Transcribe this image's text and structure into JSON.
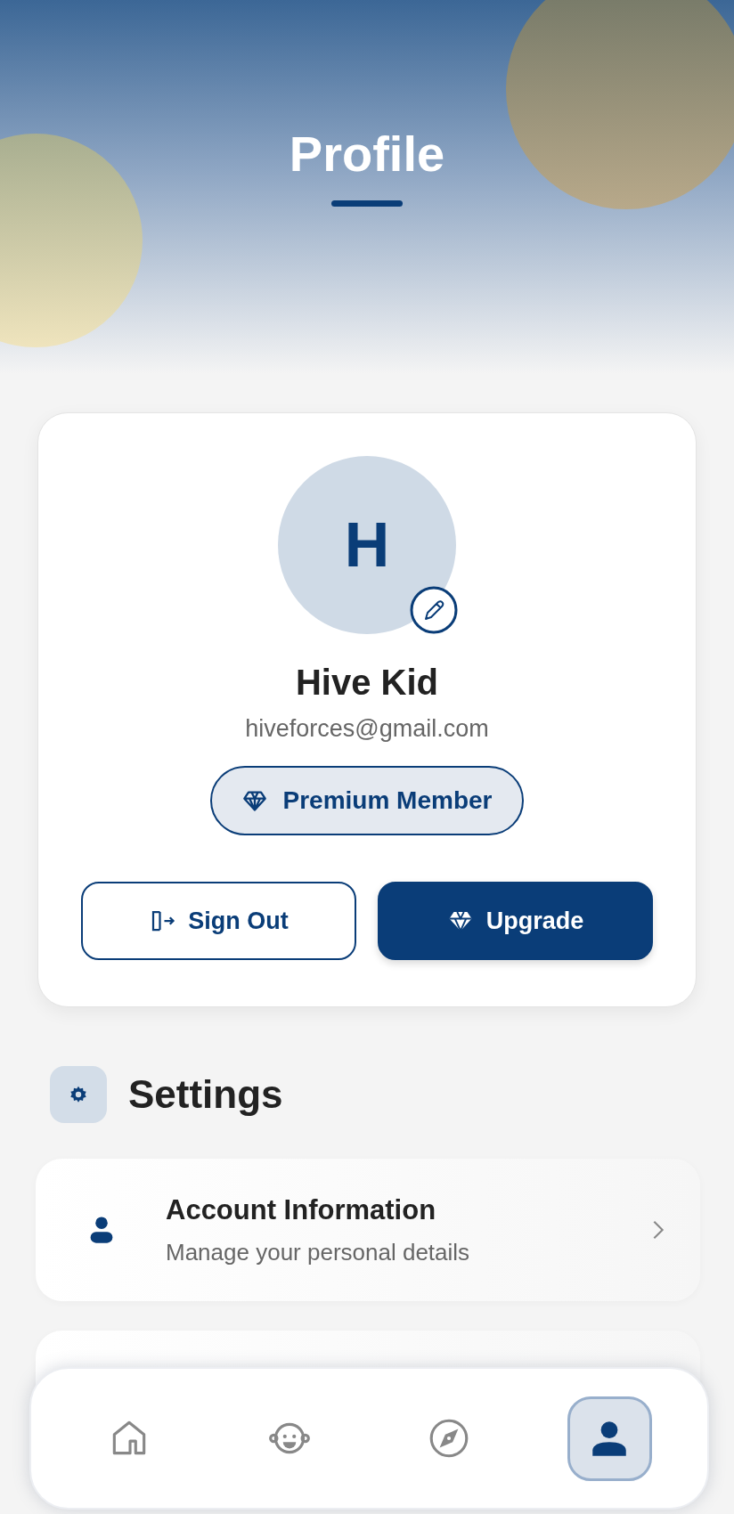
{
  "header": {
    "title": "Profile"
  },
  "profile": {
    "initial": "H",
    "name": "Hive Kid",
    "email": "hiveforces@gmail.com",
    "badge": "Premium Member",
    "buttons": [
      {
        "label": "Sign Out",
        "kind": "outline"
      },
      {
        "label": "Upgrade",
        "kind": "primary"
      }
    ]
  },
  "settings": {
    "title": "Settings",
    "items": [
      {
        "title": "Account Information",
        "subtitle": "Manage your personal details"
      }
    ]
  },
  "bottom_nav": [
    {
      "kind": "home",
      "selected": false
    },
    {
      "kind": "kid",
      "selected": false
    },
    {
      "kind": "explore",
      "selected": false
    },
    {
      "kind": "profile",
      "selected": true
    }
  ]
}
